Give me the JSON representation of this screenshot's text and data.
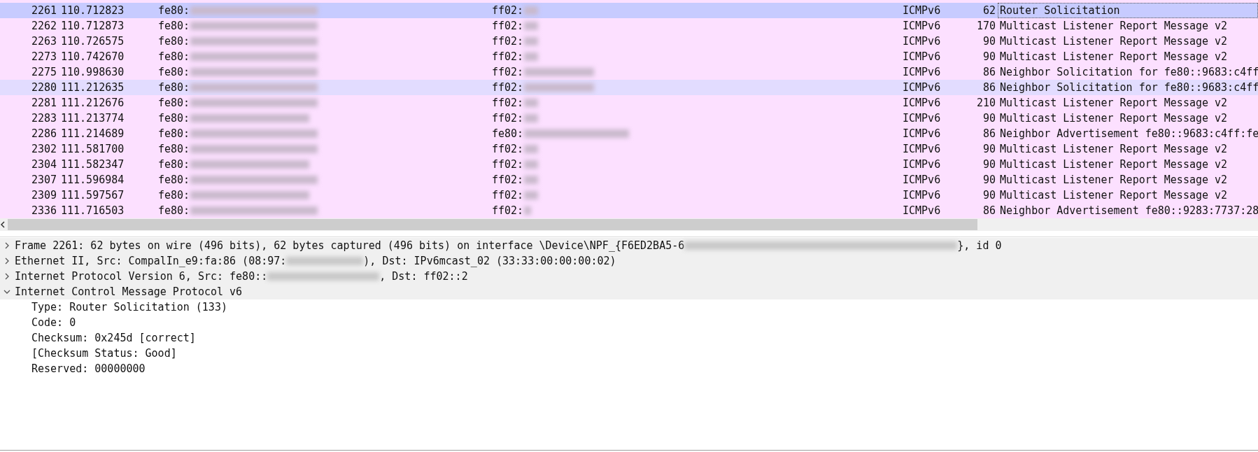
{
  "packet_list": {
    "rows": [
      {
        "no": "2261",
        "time": "110.712823",
        "source": "fe80:",
        "destination": "ff02:",
        "protocol": "ICMPv6",
        "length": "62",
        "info": "Router Solicitation",
        "selected": true,
        "hovered": false
      },
      {
        "no": "2262",
        "time": "110.712873",
        "source": "fe80:",
        "destination": "ff02:",
        "protocol": "ICMPv6",
        "length": "170",
        "info": "Multicast Listener Report Message v2",
        "selected": false,
        "hovered": false
      },
      {
        "no": "2263",
        "time": "110.726575",
        "source": "fe80:",
        "destination": "ff02:",
        "protocol": "ICMPv6",
        "length": "90",
        "info": "Multicast Listener Report Message v2",
        "selected": false,
        "hovered": false
      },
      {
        "no": "2273",
        "time": "110.742670",
        "source": "fe80:",
        "destination": "ff02:",
        "protocol": "ICMPv6",
        "length": "90",
        "info": "Multicast Listener Report Message v2",
        "selected": false,
        "hovered": false
      },
      {
        "no": "2275",
        "time": "110.998630",
        "source": "fe80:",
        "destination": "ff02:",
        "protocol": "ICMPv6",
        "length": "86",
        "info": "Neighbor Solicitation for fe80::9683:c4ff",
        "selected": false,
        "hovered": false
      },
      {
        "no": "2280",
        "time": "111.212635",
        "source": "fe80:",
        "destination": "ff02:",
        "protocol": "ICMPv6",
        "length": "86",
        "info": "Neighbor Solicitation for fe80::9683:c4ff",
        "selected": false,
        "hovered": true
      },
      {
        "no": "2281",
        "time": "111.212676",
        "source": "fe80:",
        "destination": "ff02:",
        "protocol": "ICMPv6",
        "length": "210",
        "info": "Multicast Listener Report Message v2",
        "selected": false,
        "hovered": false
      },
      {
        "no": "2283",
        "time": "111.213774",
        "source": "fe80:",
        "destination": "ff02:",
        "protocol": "ICMPv6",
        "length": "90",
        "info": "Multicast Listener Report Message v2",
        "selected": false,
        "hovered": false
      },
      {
        "no": "2286",
        "time": "111.214689",
        "source": "fe80:",
        "destination": "fe80:",
        "protocol": "ICMPv6",
        "length": "86",
        "info": "Neighbor Advertisement fe80::9683:c4ff:fe",
        "selected": false,
        "hovered": false
      },
      {
        "no": "2302",
        "time": "111.581700",
        "source": "fe80:",
        "destination": "ff02:",
        "protocol": "ICMPv6",
        "length": "90",
        "info": "Multicast Listener Report Message v2",
        "selected": false,
        "hovered": false
      },
      {
        "no": "2304",
        "time": "111.582347",
        "source": "fe80:",
        "destination": "ff02:",
        "protocol": "ICMPv6",
        "length": "90",
        "info": "Multicast Listener Report Message v2",
        "selected": false,
        "hovered": false
      },
      {
        "no": "2307",
        "time": "111.596984",
        "source": "fe80:",
        "destination": "ff02:",
        "protocol": "ICMPv6",
        "length": "90",
        "info": "Multicast Listener Report Message v2",
        "selected": false,
        "hovered": false
      },
      {
        "no": "2309",
        "time": "111.597567",
        "source": "fe80:",
        "destination": "ff02:",
        "protocol": "ICMPv6",
        "length": "90",
        "info": "Multicast Listener Report Message v2",
        "selected": false,
        "hovered": false
      },
      {
        "no": "2336",
        "time": "111.716503",
        "source": "fe80:",
        "destination": "ff02:",
        "protocol": "ICMPv6",
        "length": "86",
        "info": "Neighbor Advertisement fe80::9283:7737:28",
        "selected": false,
        "hovered": false
      }
    ]
  },
  "packet_details": {
    "items": [
      {
        "text": "Frame 2261: 62 bytes on wire (496 bits), 62 bytes captured (496 bits) on interface \\Device\\NPF_{F6ED2BA5-6",
        "text_after_blur": "}, id 0",
        "expanded": false
      },
      {
        "text": "Ethernet II, Src: CompalIn_e9:fa:86 (08:97:",
        "text_after_blur": "), Dst: IPv6mcast_02 (33:33:00:00:00:02)",
        "expanded": false
      },
      {
        "text": "Internet Protocol Version 6, Src: fe80::",
        "text_after_blur": ", Dst: ff02::2",
        "expanded": false
      },
      {
        "text": "Internet Control Message Protocol v6",
        "expanded": true,
        "children": [
          {
            "text": "Type: Router Solicitation (133)"
          },
          {
            "text": "Code: 0"
          },
          {
            "text": "Checksum: 0x245d [correct]"
          },
          {
            "text": "[Checksum Status: Good]"
          },
          {
            "text": "Reserved: 00000000"
          }
        ]
      }
    ]
  }
}
